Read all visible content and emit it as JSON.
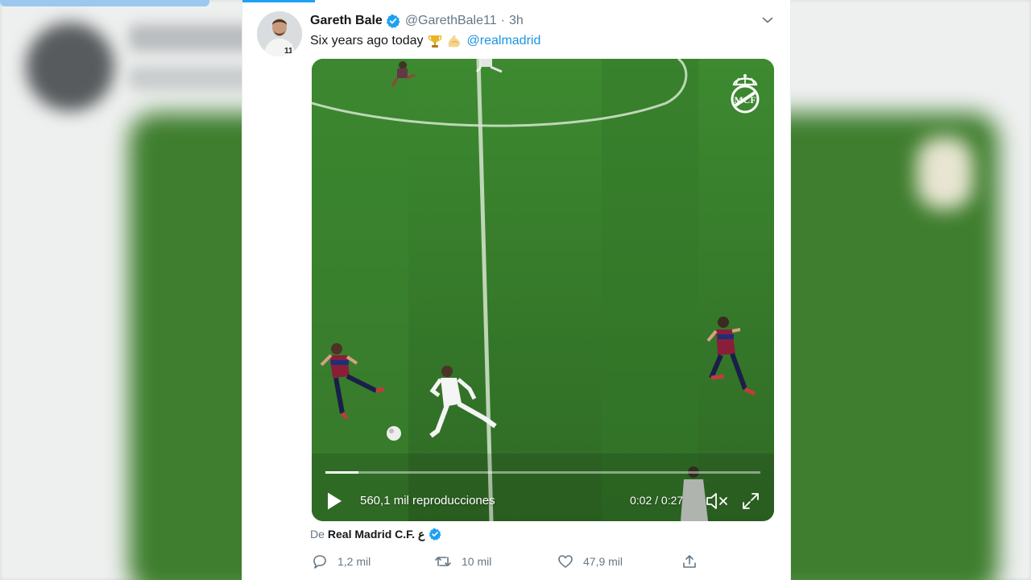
{
  "tweet": {
    "author_name": "Gareth Bale",
    "handle": "@GarethBale11",
    "separator": "·",
    "time": "3h",
    "text": "Six years ago today",
    "emojis": [
      "trophy-icon",
      "flexed-biceps-icon"
    ],
    "mention": "@realmadrid"
  },
  "media": {
    "views_text": "560,1 mil reproducciones",
    "timecode": "0:02 / 0:27",
    "progress": 0.075,
    "watermark": "real-madrid-crest"
  },
  "attribution": {
    "prefix": "De",
    "name": "Real Madrid C.F. ع"
  },
  "actions": {
    "replies": "1,2 mil",
    "retweets": "10 mil",
    "likes": "47,9 mil"
  },
  "colors": {
    "accent": "#1da1f2",
    "link": "#1b95e0",
    "pitch": "#3b7d2f",
    "secondary_text": "#657786"
  }
}
